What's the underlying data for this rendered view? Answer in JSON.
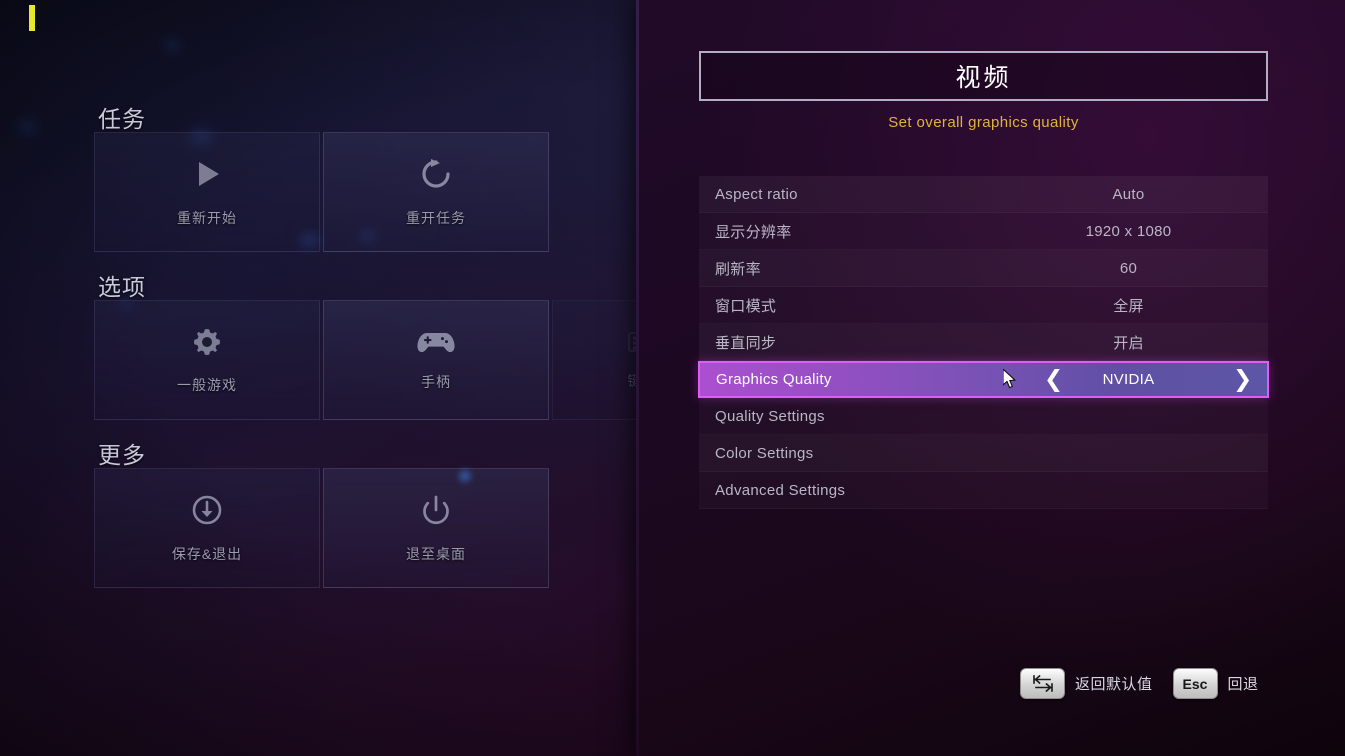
{
  "panel": {
    "title": "视频",
    "subtitle": "Set overall graphics quality",
    "rows": [
      {
        "name": "Aspect ratio",
        "value": "Auto"
      },
      {
        "name": "显示分辨率",
        "value": "1920 x 1080"
      },
      {
        "name": "刷新率",
        "value": "60"
      },
      {
        "name": "窗口模式",
        "value": "全屏"
      },
      {
        "name": "垂直同步",
        "value": "开启"
      },
      {
        "name": "Graphics Quality",
        "value": "NVIDIA"
      },
      {
        "name": "Quality Settings",
        "value": ""
      },
      {
        "name": "Color Settings",
        "value": ""
      },
      {
        "name": "Advanced Settings",
        "value": ""
      }
    ],
    "selected_index": 5,
    "arrow_left": "❮",
    "arrow_right": "❯",
    "highlight_color": "#ab4fd0",
    "accent_color": "#dd5ef2",
    "subtitle_color": "#e0b33c"
  },
  "menu": {
    "sections": [
      {
        "title": "任务",
        "tiles": [
          {
            "label": "重新开始",
            "icon": "play-icon"
          },
          {
            "label": "重开任务",
            "icon": "restart-icon"
          }
        ]
      },
      {
        "title": "选项",
        "tiles": [
          {
            "label": "一般游戏",
            "icon": "gear-icon"
          },
          {
            "label": "手柄",
            "icon": "gamepad-icon"
          },
          {
            "label": "键盘与鼠标",
            "icon": "keyboard-mouse-icon"
          }
        ]
      },
      {
        "title": "更多",
        "tiles": [
          {
            "label": "保存&退出",
            "icon": "save-exit-icon"
          },
          {
            "label": "退至桌面",
            "icon": "power-icon"
          }
        ]
      }
    ]
  },
  "footer": {
    "reset_key": "tab-key-icon",
    "reset_label": "返回默认值",
    "back_key": "Esc",
    "back_label": "回退"
  }
}
